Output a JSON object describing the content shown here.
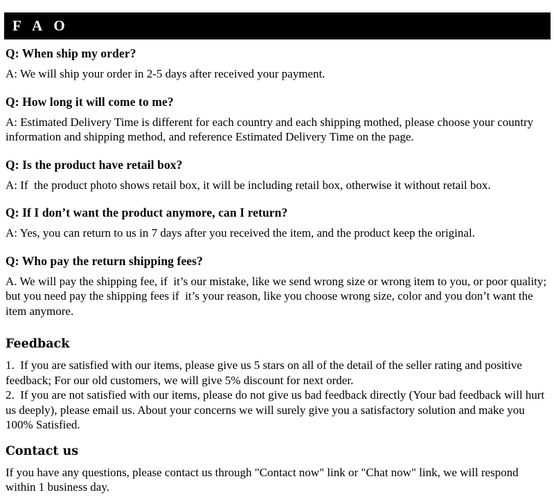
{
  "header": {
    "title": "F A O",
    "background_color": "#000000",
    "text_color": "#ffffff"
  },
  "faq": {
    "items": [
      {
        "question": "Q: When ship my order?",
        "answer": "A: We will ship your order in 2-5 days after received your payment."
      },
      {
        "question": "Q: How long it will come to me?",
        "answer": "A: Estimated Delivery Time is different for each country and each shipping mothed, please choose your country information and shipping method, and reference Estimated Delivery Time on the page."
      },
      {
        "question": "Q: Is the product have retail box?",
        "answer": "A: If  the product photo shows retail box, it will be including retail box, otherwise it without retail box."
      },
      {
        "question": "Q: If I don’t want the product anymore, can I return?",
        "answer": "A: Yes, you can return to us in 7 days after you received the item, and the product keep the original."
      },
      {
        "question": "Q: Who pay the return shipping fees?",
        "answer": "A. We will pay the shipping fee, if  it’s our mistake, like we send wrong size or wrong item to you, or poor quality; but you need pay the shipping fees if  it’s your reason, like you choose wrong size, color and you don’t want the item anymore."
      }
    ]
  },
  "feedback": {
    "heading": "Feedback",
    "body": "1.  If you are satisfied with our items, please give us 5 stars on all of the detail of the seller rating and positive feedback; For our old customers, we will give 5% discount for next order.\n2.  If you are not satisfied with our items, please do not give us bad feedback directly (Your bad feedback will hurt us deeply), please email us. About your concerns we will surely give you a satisfactory solution and make you 100% Satisfied."
  },
  "contact": {
    "heading": "Contact us",
    "body": "If you have any questions, please contact us through \"Contact now\" link or \"Chat now\" link, we will respond within 1 business day."
  }
}
